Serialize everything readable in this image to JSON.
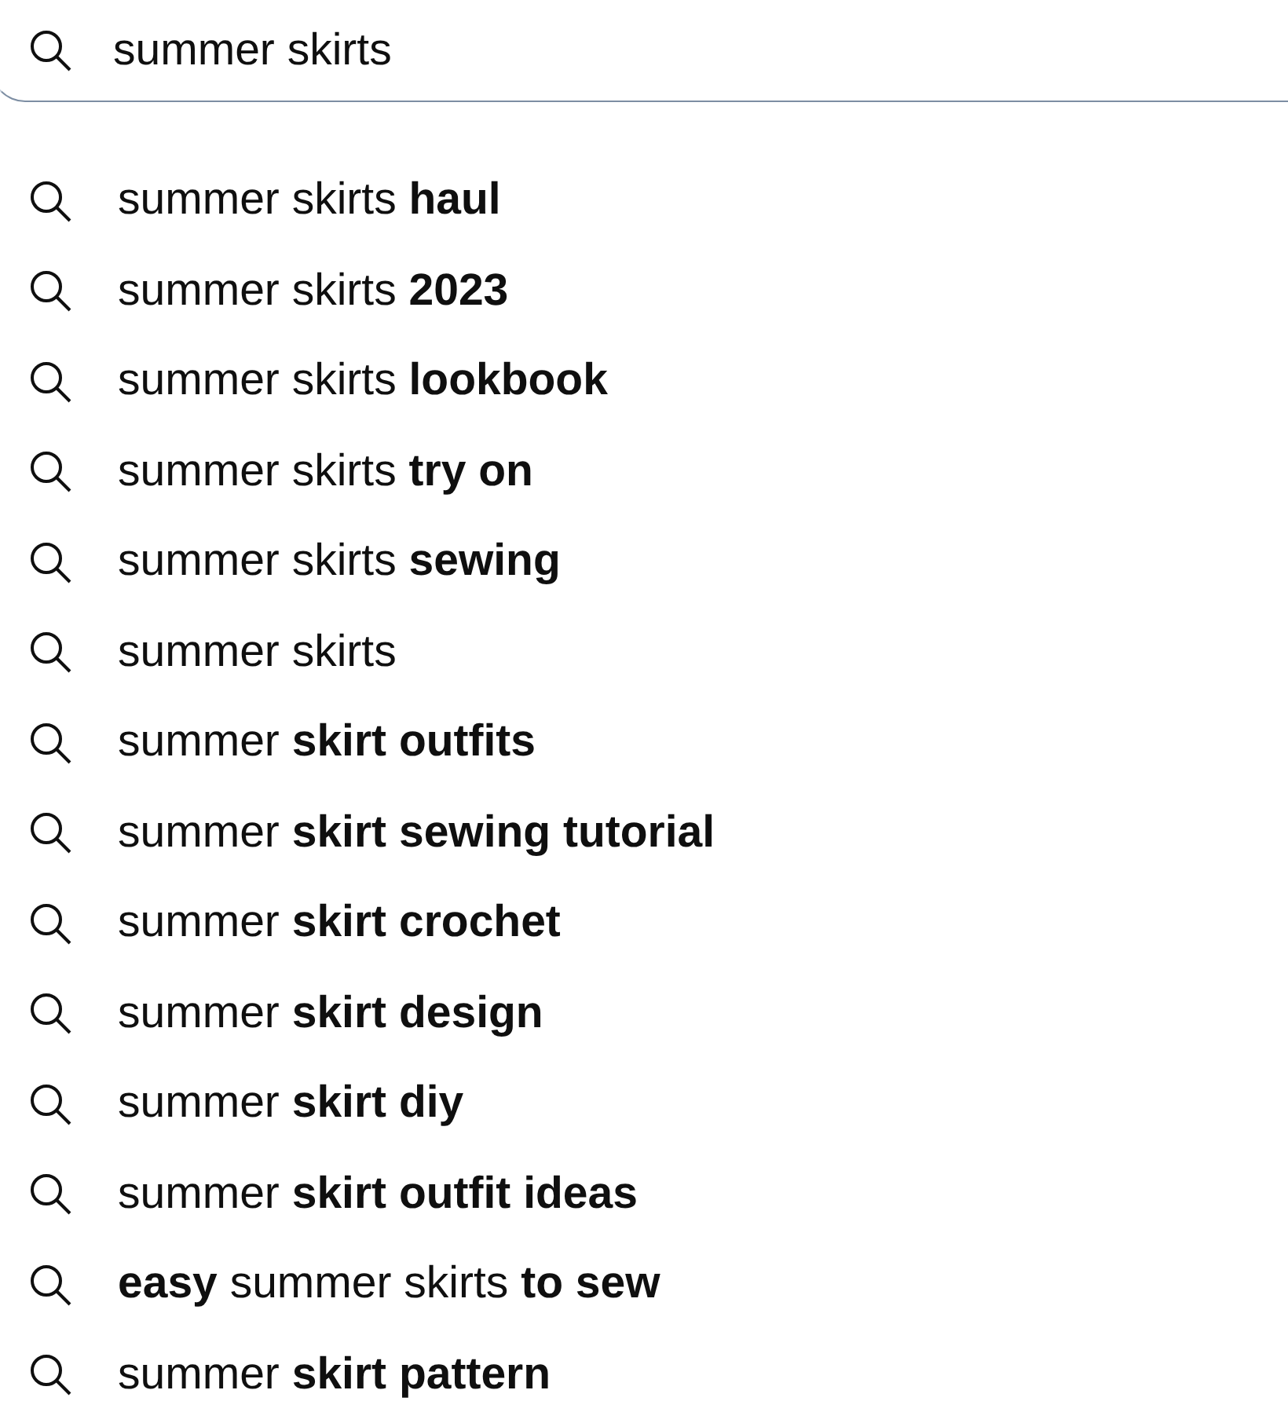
{
  "search": {
    "value": "summer skirts"
  },
  "suggestions": [
    {
      "text": "summer skirts **haul**"
    },
    {
      "text": "summer skirts **2023**"
    },
    {
      "text": "summer skirts **lookbook**"
    },
    {
      "text": "summer skirts **try on**"
    },
    {
      "text": "summer skirts **sewing**"
    },
    {
      "text": "summer skirts"
    },
    {
      "text": "summer **skirt outfits**"
    },
    {
      "text": "summer **skirt sewing tutorial**"
    },
    {
      "text": "summer **skirt crochet**"
    },
    {
      "text": "summer **skirt design**"
    },
    {
      "text": "summer **skirt diy**"
    },
    {
      "text": "summer **skirt outfit ideas**"
    },
    {
      "text": "**easy** summer skirts **to sew**"
    },
    {
      "text": "summer **skirt pattern**"
    }
  ]
}
